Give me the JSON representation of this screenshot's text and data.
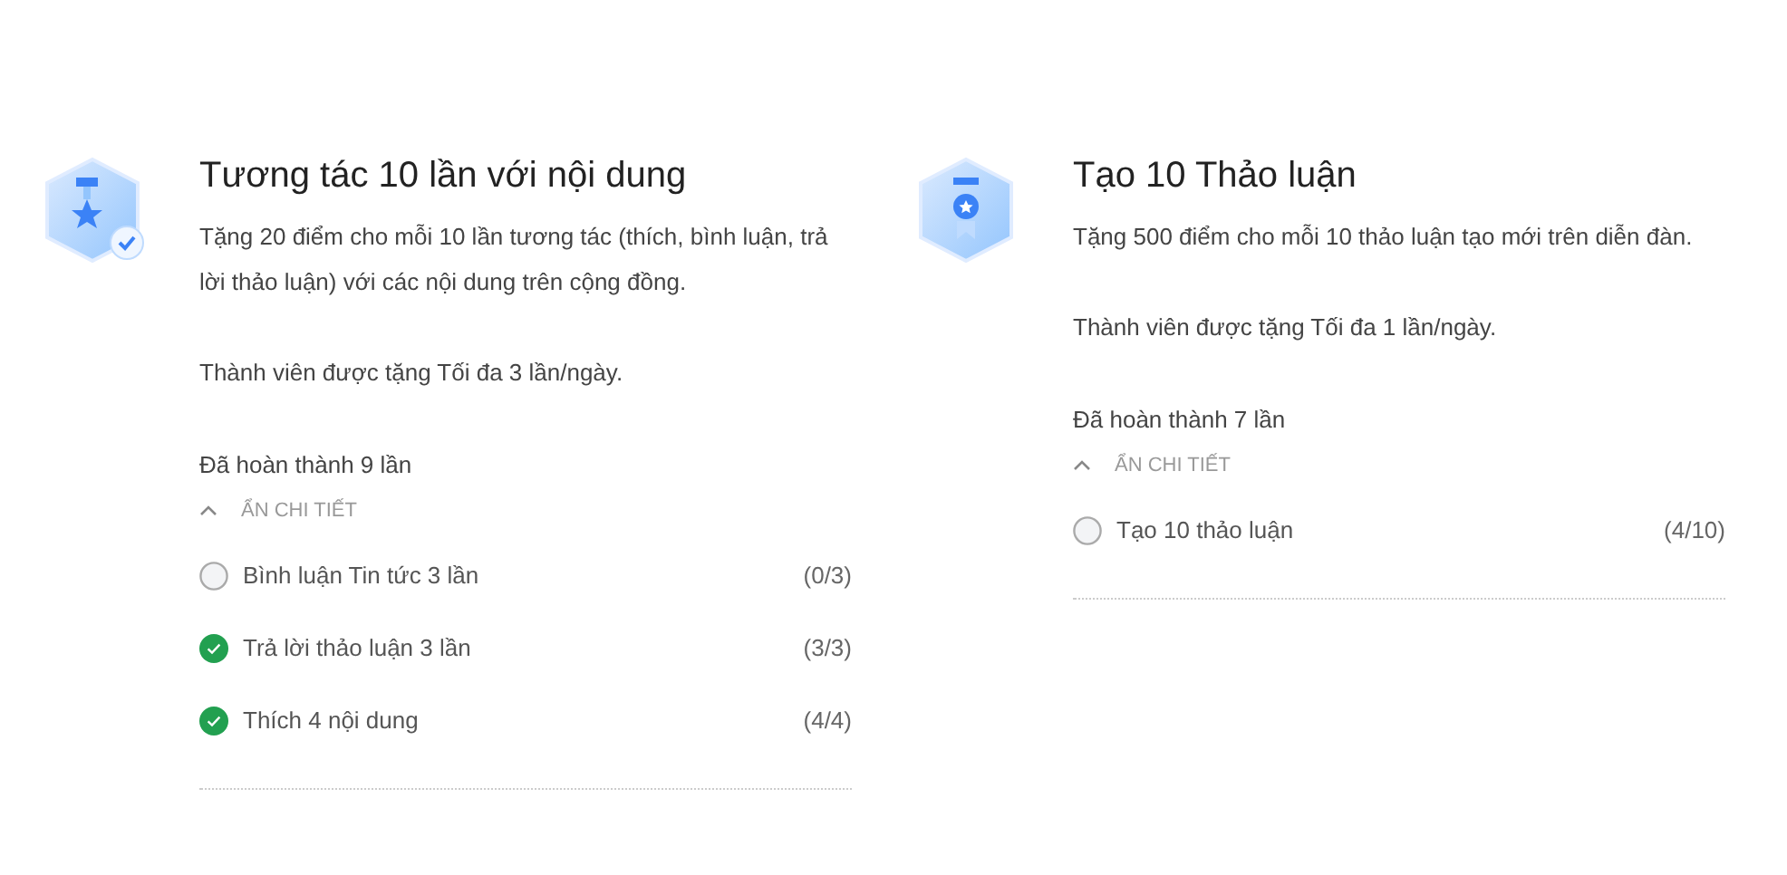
{
  "tasks": [
    {
      "kind": "star",
      "title": "Tương tác 10 lần với nội dung",
      "description": "Tặng 20 điểm cho mỗi 10 lần tương tác (thích, bình luận, trả lời thảo luận) với các nội dung trên cộng đồng.",
      "limit": "Thành viên được tặng Tối đa 3 lần/ngày.",
      "completed": "Đã hoàn thành 9 lần",
      "toggle": "ẨN CHI TIẾT",
      "expanded": true,
      "items": [
        {
          "label": "Bình luận Tin tức 3 lần",
          "progress": "(0/3)",
          "done": false
        },
        {
          "label": "Trả lời thảo luận 3 lần",
          "progress": "(3/3)",
          "done": true
        },
        {
          "label": "Thích 4 nội dung",
          "progress": "(4/4)",
          "done": true
        }
      ]
    },
    {
      "kind": "ribbon",
      "title": "Tạo 10 Thảo luận",
      "description": "Tặng 500 điểm cho mỗi 10 thảo luận tạo mới trên diễn đàn.",
      "limit": "Thành viên được tặng Tối đa 1 lần/ngày.",
      "completed": "Đã hoàn thành 7 lần",
      "toggle": "ẨN CHI TIẾT",
      "expanded": true,
      "items": [
        {
          "label": "Tạo 10 thảo luận",
          "progress": "(4/10)",
          "done": false
        }
      ]
    }
  ]
}
